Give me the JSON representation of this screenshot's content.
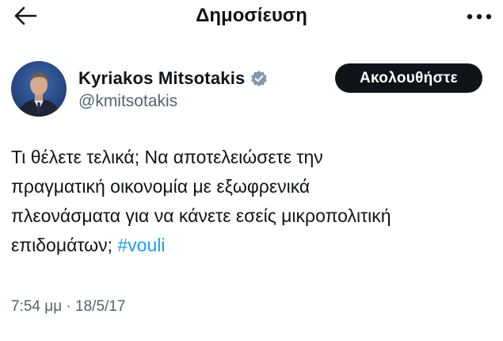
{
  "header": {
    "title": "Δημοσίευση",
    "back_icon": "arrow-left-icon",
    "more_icon": "more-horizontal-icon"
  },
  "author": {
    "name": "Kyriakos Mitsotakis",
    "handle": "@kmitsotakis",
    "verified_icon": "verified-badge-icon",
    "verified_color": "#829aab"
  },
  "follow_button": {
    "label": "Ακολουθήστε",
    "background": "#0f1419"
  },
  "tweet": {
    "line1": "Τι θέλετε τελικά; Να αποτελειώσετε την",
    "line2": "πραγματική οικονομία με εξωφρενικά",
    "line3": "πλεονάσματα για να κάνετε εσείς μικροπολιτική",
    "line4": "επιδομάτων;",
    "hashtag": "#vouli",
    "hashtag_color": "#1d9bf0"
  },
  "meta": {
    "timestamp": "7:54 μμ · 18/5/17"
  }
}
